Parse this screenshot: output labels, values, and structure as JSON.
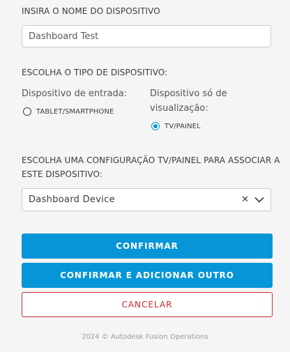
{
  "device_name": {
    "label": "INSIRA O NOME DO DISPOSITIVO",
    "value": "Dashboard Test"
  },
  "device_type": {
    "label": "ESCOLHA O TIPO DE DISPOSITIVO:",
    "input_column": {
      "heading": "Dispositivo de entrada:",
      "option_label": "TABLET/SMARTPHONE",
      "selected": false
    },
    "view_column": {
      "heading_line1": "Dispositivo só de",
      "heading_line2": "visualização:",
      "option_label": "TV/PAINEL",
      "selected": true
    }
  },
  "config": {
    "label_line1": "ESCOLHA UMA CONFIGURAÇÃO TV/PAINEL PARA ASSOCIAR A",
    "label_line2": "ESTE DISPOSITIVO:",
    "selected_value": "Dashboard Device"
  },
  "buttons": {
    "confirm": "CONFIRMAR",
    "confirm_add": "CONFIRMAR E ADICIONAR OUTRO",
    "cancel": "CANCELAR"
  },
  "footer": {
    "text": "2024 © Autodesk Fusion Operations"
  },
  "colors": {
    "accent": "#0696d7",
    "danger": "#c32c2c",
    "background": "#f5f5f5"
  }
}
